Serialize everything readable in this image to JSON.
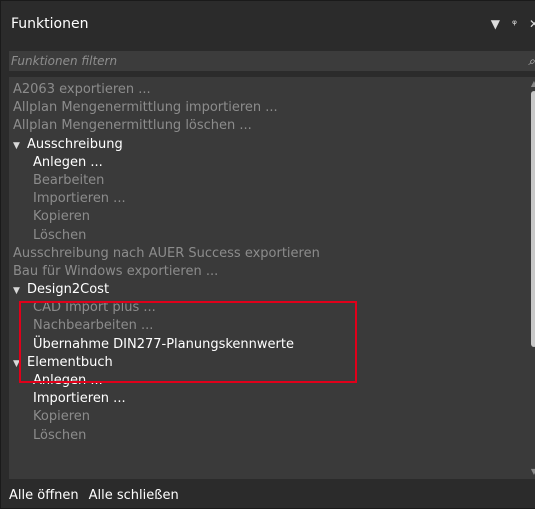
{
  "panel": {
    "title": "Funktionen",
    "controls": {
      "dropdown": "▼",
      "pin": "ᵠ",
      "close": "✕"
    }
  },
  "filter": {
    "placeholder": "Funktionen filtern",
    "value": ""
  },
  "items": [
    {
      "label": "A2063 exportieren ...",
      "level": 0,
      "state": "dim"
    },
    {
      "label": "Allplan Mengenermittlung importieren ...",
      "level": 0,
      "state": "dim"
    },
    {
      "label": "Allplan Mengenermittlung löschen ...",
      "level": 0,
      "state": "dim"
    },
    {
      "label": "Ausschreibung",
      "level": 0,
      "state": "bright",
      "group": true
    },
    {
      "label": "Anlegen ...",
      "level": 1,
      "state": "bright"
    },
    {
      "label": "Bearbeiten",
      "level": 1,
      "state": "dim"
    },
    {
      "label": "Importieren ...",
      "level": 1,
      "state": "dim"
    },
    {
      "label": "Kopieren",
      "level": 1,
      "state": "dim"
    },
    {
      "label": "Löschen",
      "level": 1,
      "state": "dim"
    },
    {
      "label": "Ausschreibung nach AUER Success exportieren",
      "level": 0,
      "state": "dim"
    },
    {
      "label": "Bau für Windows exportieren ...",
      "level": 0,
      "state": "dim"
    },
    {
      "label": "Design2Cost",
      "level": 0,
      "state": "bright",
      "group": true
    },
    {
      "label": "CAD Import plus ...",
      "level": 1,
      "state": "dim"
    },
    {
      "label": "Nachbearbeiten ...",
      "level": 1,
      "state": "dim"
    },
    {
      "label": "Übernahme DIN277-Planungskennwerte",
      "level": 1,
      "state": "bright"
    },
    {
      "label": "Elementbuch",
      "level": 0,
      "state": "bright",
      "group": true
    },
    {
      "label": "Anlegen ...",
      "level": 1,
      "state": "bright"
    },
    {
      "label": "Importieren ...",
      "level": 1,
      "state": "bright"
    },
    {
      "label": "Kopieren",
      "level": 1,
      "state": "dim"
    },
    {
      "label": "Löschen",
      "level": 1,
      "state": "dim"
    }
  ],
  "footer": {
    "open_all": "Alle öffnen",
    "close_all": "Alle schließen"
  },
  "colors": {
    "panel_bg": "#2b2b2b",
    "list_bg": "#3a3a3a",
    "enabled": "#ffffff",
    "disabled": "#8c8c8c",
    "highlight": "#e0001a"
  },
  "icons": {
    "caret": "caret-down-icon",
    "search": "search-icon",
    "scroll_up": "scroll-up-icon",
    "scroll_down": "scroll-down-icon"
  }
}
